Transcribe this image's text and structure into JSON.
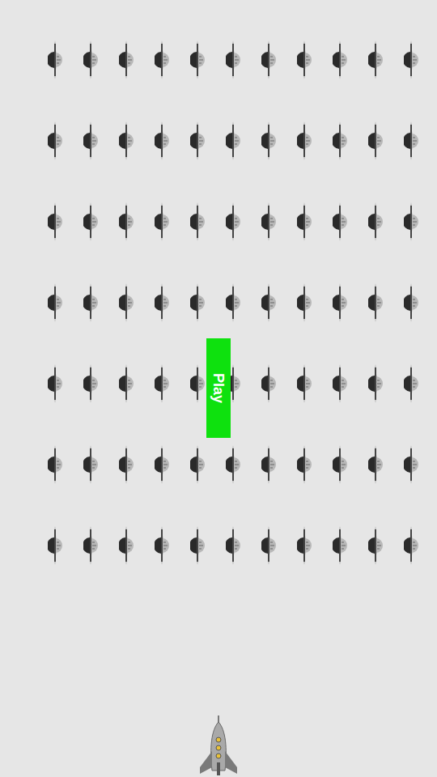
{
  "play_button": {
    "label": "Play"
  },
  "invaders": {
    "rows": [
      {
        "aliens": [
          {
            "alive": true
          },
          {
            "alive": true
          },
          {
            "alive": true
          },
          {
            "alive": true
          },
          {
            "alive": true
          },
          {
            "alive": true
          },
          {
            "alive": true
          },
          {
            "alive": true
          },
          {
            "alive": true
          },
          {
            "alive": true
          },
          {
            "alive": true
          }
        ]
      },
      {
        "aliens": [
          {
            "alive": true
          },
          {
            "alive": true
          },
          {
            "alive": true
          },
          {
            "alive": true
          },
          {
            "alive": true
          },
          {
            "alive": true
          },
          {
            "alive": true
          },
          {
            "alive": true
          },
          {
            "alive": true
          },
          {
            "alive": true
          },
          {
            "alive": true
          }
        ]
      },
      {
        "aliens": [
          {
            "alive": true
          },
          {
            "alive": true
          },
          {
            "alive": true
          },
          {
            "alive": true
          },
          {
            "alive": true
          },
          {
            "alive": true
          },
          {
            "alive": true
          },
          {
            "alive": true
          },
          {
            "alive": true
          },
          {
            "alive": true
          },
          {
            "alive": true
          }
        ]
      },
      {
        "aliens": [
          {
            "alive": true
          },
          {
            "alive": true
          },
          {
            "alive": true
          },
          {
            "alive": true
          },
          {
            "alive": true
          },
          {
            "alive": true
          },
          {
            "alive": true
          },
          {
            "alive": true
          },
          {
            "alive": true
          },
          {
            "alive": true
          },
          {
            "alive": true
          }
        ]
      },
      {
        "aliens": [
          {
            "alive": true
          },
          {
            "alive": true
          },
          {
            "alive": true
          },
          {
            "alive": true
          },
          {
            "alive": true
          },
          {
            "alive": true
          },
          {
            "alive": true
          },
          {
            "alive": true
          },
          {
            "alive": true
          },
          {
            "alive": true
          },
          {
            "alive": true
          }
        ]
      },
      {
        "aliens": [
          {
            "alive": true
          },
          {
            "alive": true
          },
          {
            "alive": true
          },
          {
            "alive": true
          },
          {
            "alive": true
          },
          {
            "alive": true
          },
          {
            "alive": true
          },
          {
            "alive": true
          },
          {
            "alive": true
          },
          {
            "alive": true
          },
          {
            "alive": true
          }
        ]
      },
      {
        "aliens": [
          {
            "alive": true
          },
          {
            "alive": true
          },
          {
            "alive": true
          },
          {
            "alive": true
          },
          {
            "alive": true
          },
          {
            "alive": true
          },
          {
            "alive": true
          },
          {
            "alive": true
          },
          {
            "alive": true
          },
          {
            "alive": true
          },
          {
            "alive": true
          }
        ]
      }
    ]
  }
}
